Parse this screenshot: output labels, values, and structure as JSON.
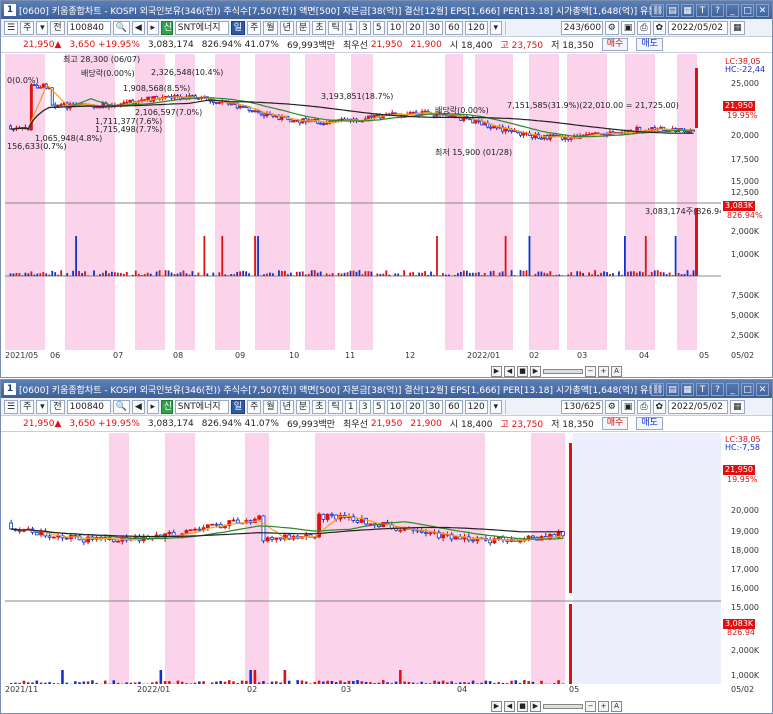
{
  "panels": [
    {
      "title": "[0600] 키움종합차트 - KOSPI 외국인보유(346(천)) 주식수[7,507(천)] 액면[500] 자본금[38(억)] 결산[12월] EPS[1,666] PER[13.18] 시가총액[1,648(억)] 유통비율[27.",
      "num": "1",
      "toolbar": {
        "code": "100840",
        "name": "SNT에너지",
        "zoom": "243/600",
        "date": "2022/05/02"
      },
      "x_labels": [
        "2021/05",
        "06",
        "07",
        "08",
        "09",
        "10",
        "11",
        "12",
        "2022/01",
        "02",
        "03",
        "04",
        "05",
        "05/02"
      ],
      "y_labels": [
        "25,000",
        "22,500",
        "20,000",
        "17,500",
        "15,000",
        "12,500",
        "10,000",
        "7,500",
        "2,000K",
        "1,000K",
        "7,500K",
        "5,000K",
        "2,500K"
      ],
      "badges": {
        "lc": "LC:38,05",
        "hc": "HC:-22,44",
        "price": "21,950",
        "pct": "19.95%",
        "vol": "3,083K",
        "volpct": "826.94%"
      },
      "annotations": {
        "high": "최고 28,300 (06/07)",
        "div1": "배당락(0.00%)",
        "zero": "0(0.0%)",
        "a1": "2,326,548(10.4%)",
        "a2": "1,908,568(8.5%)",
        "a3": "3,193,851(18.7%)",
        "a4": "7,151,585(31.9%)(22,010.00 = 21,725.00)",
        "a5": "2,106,597(7.0%)",
        "a6": "1,711,377(7.6%)",
        "a7": "1,715,498(7.7%)",
        "a8": "1,065,948(4.8%)",
        "a9": "156,633(0.7%)",
        "div2": "배당락(0.00%)",
        "low": "최저 15,900 (01/28)",
        "vol": "3,083,174주(826.94%)"
      }
    },
    {
      "title": "[0600] 키움종합차트 - KOSPI 외국인보유(346(천)) 주식수[7,507(천)] 액면[500] 자본금[38(억)] 결산[12월] EPS[1,666] PER[13.18] 시가총액[1,648(억)] 유통비율[27.",
      "num": "1",
      "toolbar": {
        "code": "100840",
        "name": "SNT에너지",
        "zoom": "130/625",
        "date": "2022/05/02"
      },
      "x_labels": [
        "2021/11",
        "2022/01",
        "02",
        "03",
        "04",
        "05",
        "05/02"
      ],
      "y_labels": [
        "20,000",
        "19,000",
        "18,000",
        "17,000",
        "16,000",
        "15,000",
        "2,000K",
        "1,000K"
      ],
      "badges": {
        "lc": "LC:38,05",
        "hc": "HC:-7,58",
        "price": "21,950",
        "pct": "19.95%",
        "vol": "3,083K",
        "volpct": "826.94"
      }
    }
  ],
  "toolbar_labels": {
    "ju": "주",
    "jeon": "전",
    "il": "일",
    "ju2": "주",
    "wol": "월",
    "nyeon": "년",
    "bun": "분",
    "cho": "초",
    "tik": "틱",
    "n1": "1",
    "n3": "3",
    "n5": "5",
    "n10": "10",
    "n20": "20",
    "n30": "30",
    "n60": "60",
    "n120": "120"
  },
  "info": {
    "price": "21,950▲",
    "change": "3,650 +19.95%",
    "volume": "3,083,174",
    "vol_ratio": "826.94% 41.07%",
    "amount": "69,993백만",
    "best_label": "최우선",
    "ask": "21,950",
    "bid": "21,900",
    "open": "시 18,400",
    "high": "고 23,750",
    "low": "저 18,350",
    "buy": "매수",
    "sell": "매도"
  },
  "colors": {
    "pink": "#fbd3ea",
    "up": "#e01010",
    "down": "#1030d0",
    "ma5": "#f2a020",
    "ma20": "#2a8a2a",
    "ma60": "#222222"
  }
}
